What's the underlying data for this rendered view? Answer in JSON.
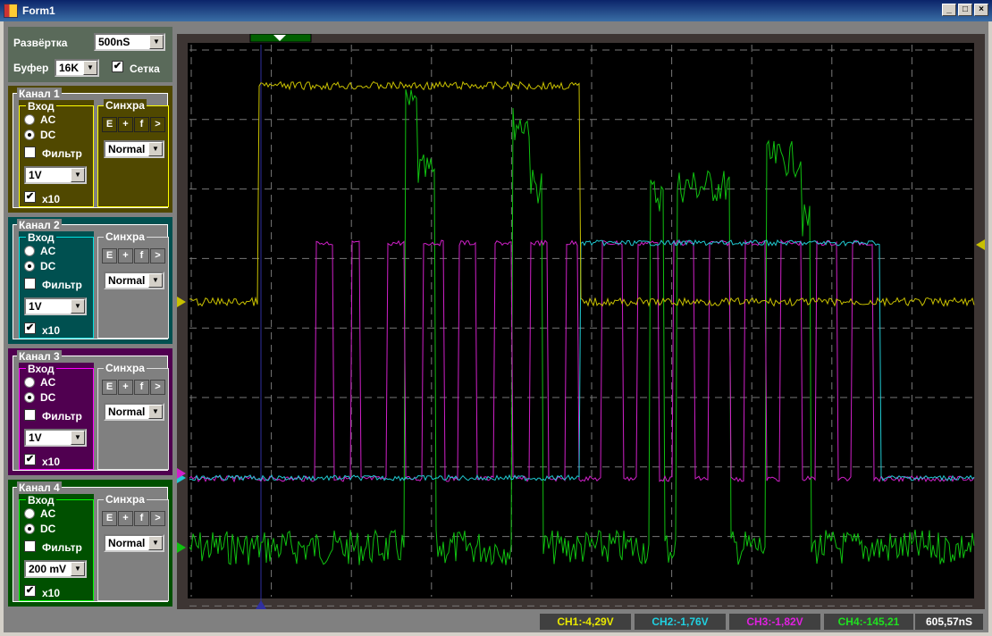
{
  "window": {
    "title": "Form1",
    "buttons": [
      "_",
      "□",
      "×"
    ]
  },
  "top": {
    "sweep_label": "Развёртка",
    "sweep_value": "500nS",
    "buffer_label": "Буфер",
    "buffer_value": "16K",
    "grid_label": "Сетка",
    "grid_checked": true
  },
  "channels": [
    {
      "title": "Канал 1",
      "input": "Вход",
      "ac": "AC",
      "dc": "DC",
      "filter": "Фильтр",
      "range": "1V",
      "x10": "x10",
      "sync": "Синхра",
      "sync_buttons": [
        "E",
        "+",
        "f",
        ">"
      ],
      "mode": "Normal",
      "bg": "#504800",
      "accent": "#ffff00",
      "sync_active": true
    },
    {
      "title": "Канал 2",
      "input": "Вход",
      "ac": "AC",
      "dc": "DC",
      "filter": "Фильтр",
      "range": "1V",
      "x10": "x10",
      "sync": "Синхра",
      "sync_buttons": [
        "E",
        "+",
        "f",
        ">"
      ],
      "mode": "Normal",
      "bg": "#005050",
      "accent": "#00e0e0",
      "sync_active": false
    },
    {
      "title": "Канал 3",
      "input": "Вход",
      "ac": "AC",
      "dc": "DC",
      "filter": "Фильтр",
      "range": "1V",
      "x10": "x10",
      "sync": "Синхра",
      "sync_buttons": [
        "E",
        "+",
        "f",
        ">"
      ],
      "mode": "Normal",
      "bg": "#500050",
      "accent": "#ff00ff",
      "sync_active": false
    },
    {
      "title": "Канал 4",
      "input": "Вход",
      "ac": "AC",
      "dc": "DC",
      "filter": "Фильтр",
      "range": "200 mV",
      "x10": "x10",
      "sync": "Синхра",
      "sync_buttons": [
        "E",
        "+",
        "f",
        ">"
      ],
      "mode": "Normal",
      "bg": "#005000",
      "accent": "#00ff00",
      "sync_active": false
    }
  ],
  "trace_colors": [
    "#c8c000",
    "#20c8d0",
    "#d020c8",
    "#10c010"
  ],
  "status": {
    "ch1": "CH1:-4,29V",
    "ch2": "CH2:-1,76V",
    "ch3": "CH3:-1,82V",
    "ch4": "CH4:-145,21",
    "time": "605,57nS"
  }
}
